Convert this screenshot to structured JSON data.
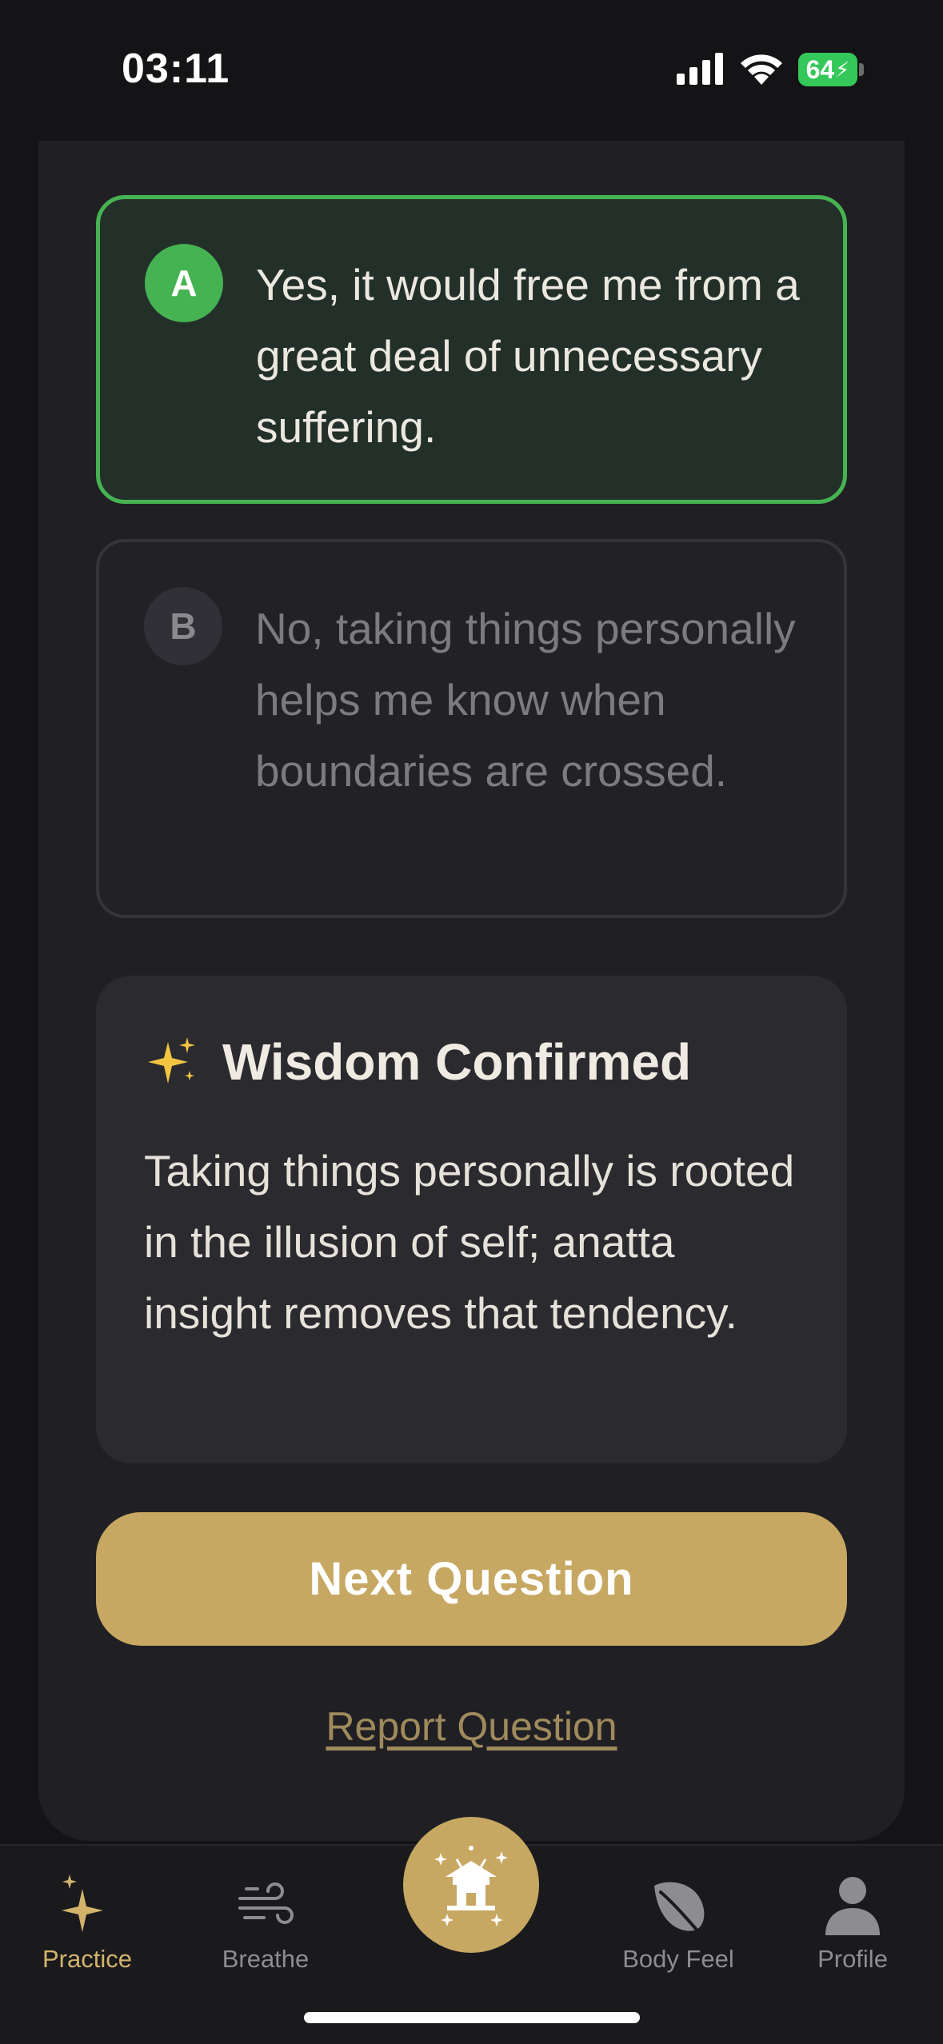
{
  "status_bar": {
    "time": "03:11",
    "battery_percent": "64"
  },
  "options": [
    {
      "letter": "A",
      "text": "Yes, it would free me from a great deal of unnecessary suffering.",
      "state": "correct"
    },
    {
      "letter": "B",
      "text": "No, taking things personally helps me know when boundaries are crossed.",
      "state": "dimmed"
    }
  ],
  "feedback": {
    "icon": "sparkles-icon",
    "title": "Wisdom Confirmed",
    "body": "Taking things personally is rooted in the illusion of self; anatta insight removes that tendency."
  },
  "actions": {
    "next_label": "Next Question",
    "report_label": "Report Question"
  },
  "tab_bar": {
    "tabs": [
      {
        "label": "Practice",
        "icon": "sparkle-icon",
        "active": true
      },
      {
        "label": "Breathe",
        "icon": "wind-icon",
        "active": false
      },
      {
        "label": "Body Feel",
        "icon": "leaf-icon",
        "active": false
      },
      {
        "label": "Profile",
        "icon": "person-icon",
        "active": false
      }
    ],
    "center_icon": "temple-icon"
  },
  "colors": {
    "accent_gold": "#c7a862",
    "correct_green": "#46b352",
    "background": "#141416",
    "card": "#202024"
  }
}
